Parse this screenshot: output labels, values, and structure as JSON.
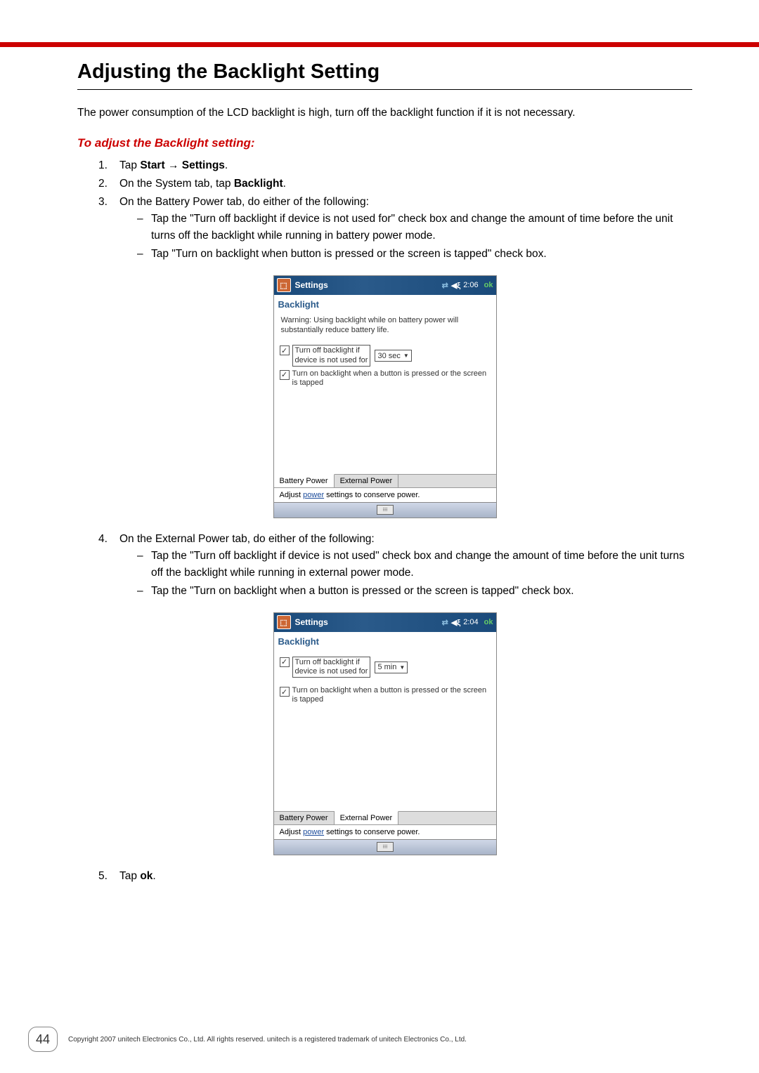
{
  "heading": "Adjusting the Backlight Setting",
  "intro": "The power consumption of the LCD backlight is high, turn off the backlight function if it is not necessary.",
  "subheading": "To adjust the Backlight setting:",
  "step1": {
    "prefix": "Tap ",
    "bold1": "Start",
    "arrow": " → ",
    "bold2": "Settings",
    "suffix": "."
  },
  "step2": {
    "prefix": "On the System tab, tap ",
    "bold": "Backlight",
    "suffix": "."
  },
  "step3": {
    "text": "On the Battery Power tab, do either of the following:",
    "bullet1": "Tap the \"Turn off backlight if device is not used for\" check box and change the amount of time before the unit turns off the backlight while running in battery power mode.",
    "bullet2": "Tap \"Turn on backlight when button is pressed or the screen is tapped\" check box."
  },
  "step4": {
    "text": "On the External Power tab, do either of the following:",
    "bullet1": "Tap the \"Turn off backlight if device is not used\" check box and change the amount of time before the unit turns off the backlight while running in external power mode.",
    "bullet2": "Tap the \"Turn on backlight when a button is pressed or the screen is tapped\" check box."
  },
  "step5": {
    "prefix": "Tap ",
    "bold": "ok",
    "suffix": "."
  },
  "shot1": {
    "title": "Settings",
    "time": "2:06",
    "ok": "ok",
    "subhead": "Backlight",
    "warning": "Warning: Using backlight while on battery power will substantially reduce battery life.",
    "chk1_line1": "Turn off backlight if",
    "chk1_line2": "device is not used for",
    "dropdown": "30 sec",
    "chk2": "Turn on backlight when a button is pressed or the screen is tapped",
    "tab1": "Battery Power",
    "tab2": "External Power",
    "footer_pre": "Adjust ",
    "footer_link": "power",
    "footer_post": " settings to conserve power."
  },
  "shot2": {
    "title": "Settings",
    "time": "2:04",
    "ok": "ok",
    "subhead": "Backlight",
    "chk1_line1": "Turn off backlight if",
    "chk1_line2": "device is not used for",
    "dropdown": "5 min",
    "chk2": "Turn on backlight when a button is pressed or the screen is tapped",
    "tab1": "Battery Power",
    "tab2": "External Power",
    "footer_pre": "Adjust ",
    "footer_link": "power",
    "footer_post": " settings to conserve power."
  },
  "page_number": "44",
  "copyright": "Copyright 2007 unitech Electronics Co., Ltd. All rights reserved. unitech is a registered trademark of unitech Electronics Co., Ltd."
}
